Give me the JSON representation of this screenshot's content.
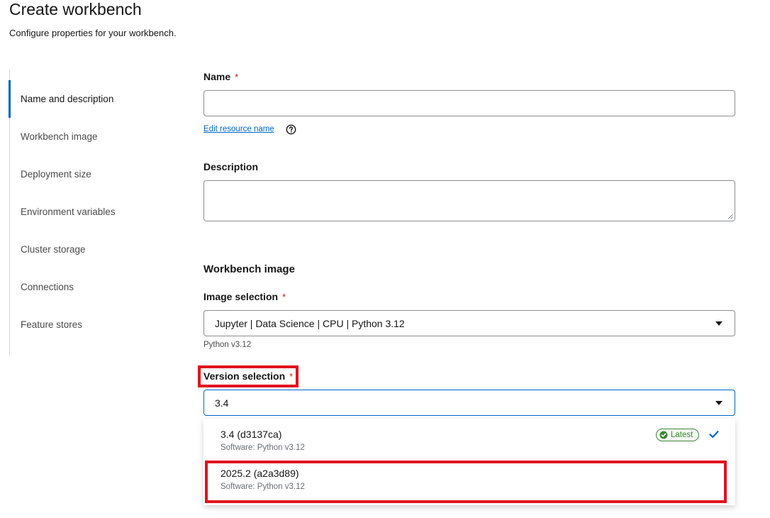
{
  "header": {
    "title": "Create workbench",
    "subtitle": "Configure properties for your workbench."
  },
  "jump_nav": {
    "items": [
      {
        "label": "Name and description",
        "active": true
      },
      {
        "label": "Workbench image"
      },
      {
        "label": "Deployment size"
      },
      {
        "label": "Environment variables"
      },
      {
        "label": "Cluster storage"
      },
      {
        "label": "Connections"
      },
      {
        "label": "Feature stores"
      }
    ]
  },
  "form": {
    "name_label": "Name",
    "required_mark": "*",
    "name_value": "",
    "edit_resource_link": "Edit resource name",
    "description_label": "Description",
    "description_value": "",
    "image_section_title": "Workbench image",
    "image_selection_label": "Image selection",
    "image_selection_value": "Jupyter | Data Science | CPU | Python 3.12",
    "image_helper": "Python v3.12",
    "version_selection_label": "Version selection",
    "version_selection_value": "3.4"
  },
  "version_options": [
    {
      "title": "3.4 (d3137ca)",
      "description": "Software: Python v3.12",
      "badge": "Latest",
      "selected": true
    },
    {
      "title": "2025.2 (a2a3d89)",
      "description": "Software: Python v3.12"
    }
  ],
  "colors": {
    "accent": "#0066cc",
    "required": "#c9190b",
    "highlight": "#e0141e",
    "success": "#3e8635"
  },
  "icons": {
    "help": "help-circle-icon",
    "caret": "caret-down-icon",
    "check": "check-icon",
    "badge": "check-circle-icon"
  }
}
